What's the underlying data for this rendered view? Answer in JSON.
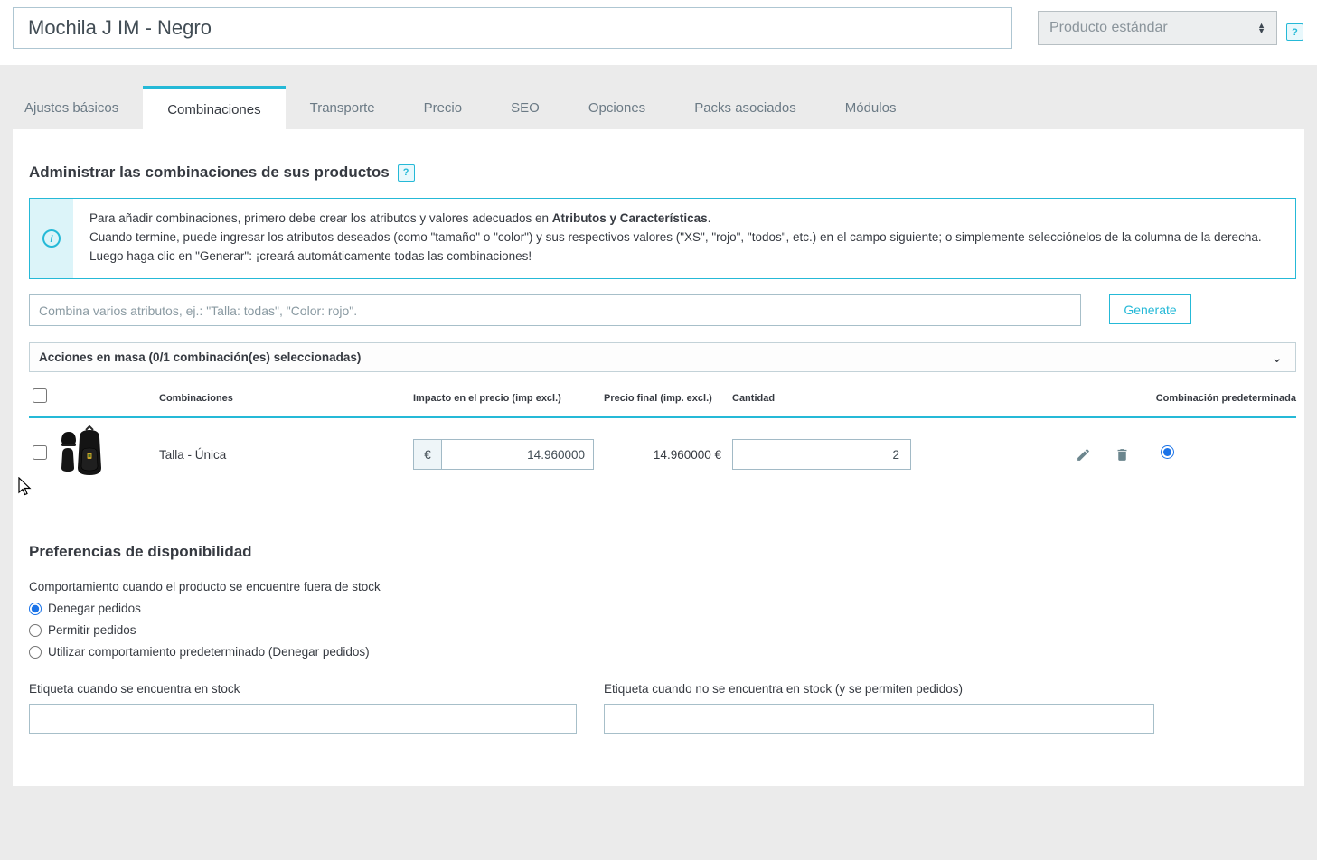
{
  "header": {
    "product_name": "Mochila J IM - Negro",
    "product_type": "Producto estándar",
    "help_badge": "?"
  },
  "tabs": [
    {
      "label": "Ajustes básicos"
    },
    {
      "label": "Combinaciones"
    },
    {
      "label": "Transporte"
    },
    {
      "label": "Precio"
    },
    {
      "label": "SEO"
    },
    {
      "label": "Opciones"
    },
    {
      "label": "Packs asociados"
    },
    {
      "label": "Módulos"
    }
  ],
  "combinations": {
    "title": "Administrar las combinaciones de sus productos",
    "info": {
      "line1_pre": "Para añadir combinaciones, primero debe crear los atributos y valores adecuados en ",
      "line1_bold": "Atributos y Características",
      "line1_post": ".",
      "line2": "Cuando termine, puede ingresar los atributos deseados (como \"tamaño\" o \"color\") y sus respectivos valores (\"XS\", \"rojo\", \"todos\", etc.) en el campo siguiente; o simplemente selecciónelos de la columna de la derecha. Luego haga clic en \"Generar\": ¡creará automáticamente todas las combinaciones!"
    },
    "attr_placeholder": "Combina varios atributos, ej.: \"Talla: todas\", \"Color: rojo\".",
    "generate_label": "Generate",
    "bulk_label": "Acciones en masa (0/1 combinación(es) seleccionadas)",
    "table": {
      "headers": {
        "combinations": "Combinaciones",
        "price_impact": "Impacto en el precio (imp excl.)",
        "final_price": "Precio final (imp. excl.)",
        "quantity": "Cantidad",
        "default": "Combinación predeterminada"
      },
      "row": {
        "name": "Talla - Única",
        "currency": "€",
        "price_impact": "14.960000",
        "final_price": "14.960000 €",
        "quantity": "2"
      }
    }
  },
  "availability": {
    "title": "Preferencias de disponibilidad",
    "behavior_label": "Comportamiento cuando el producto se encuentre fuera de stock",
    "options": [
      {
        "label": "Denegar pedidos"
      },
      {
        "label": "Permitir pedidos"
      },
      {
        "label": "Utilizar comportamiento predeterminado (Denegar pedidos)"
      }
    ],
    "in_stock_label": "Etiqueta cuando se encuentra en stock",
    "out_stock_label": "Etiqueta cuando no se encuentra en stock (y se permiten pedidos)",
    "in_stock_value": "",
    "out_stock_value": ""
  }
}
